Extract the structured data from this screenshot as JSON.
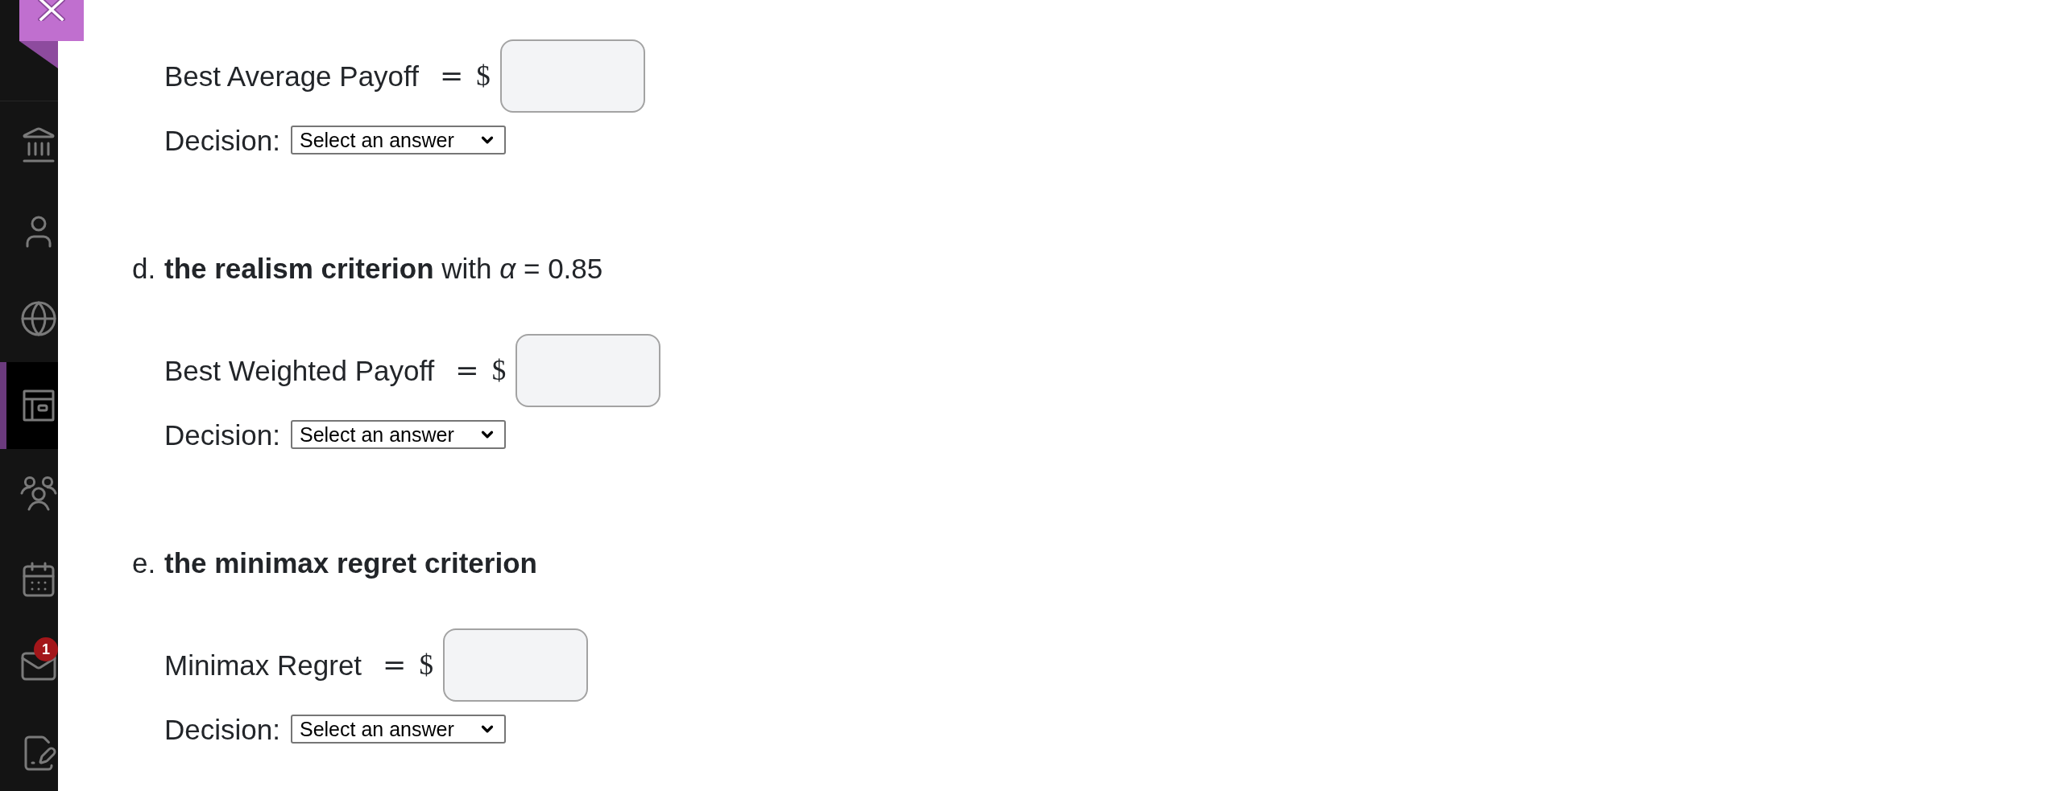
{
  "sidebar": {
    "items": [
      {
        "selected": false
      },
      {
        "selected": false
      },
      {
        "selected": false
      },
      {
        "selected": true
      },
      {
        "selected": false
      },
      {
        "selected": false
      },
      {
        "selected": false,
        "badge": "1"
      },
      {
        "selected": false
      }
    ]
  },
  "questions": [
    {
      "answer_label": "Best Average Payoff",
      "equals": "=",
      "currency": "$",
      "decision_label": "Decision:",
      "decision_value": "Select an answer"
    },
    {
      "marker": "d.",
      "heading": "**the realism criterion** with *α* = 0.85",
      "bold": false,
      "answer_label": "Best Weighted Payoff",
      "equals": "=",
      "currency": "$",
      "decision_label": "Decision:",
      "decision_value": "Select an answer"
    },
    {
      "marker": "e.",
      "heading": "the minimax regret criterion",
      "bold": true,
      "answer_label": "Minimax Regret",
      "equals": "=",
      "currency": "$",
      "decision_label": "Decision:",
      "decision_value": "Select an answer"
    }
  ]
}
